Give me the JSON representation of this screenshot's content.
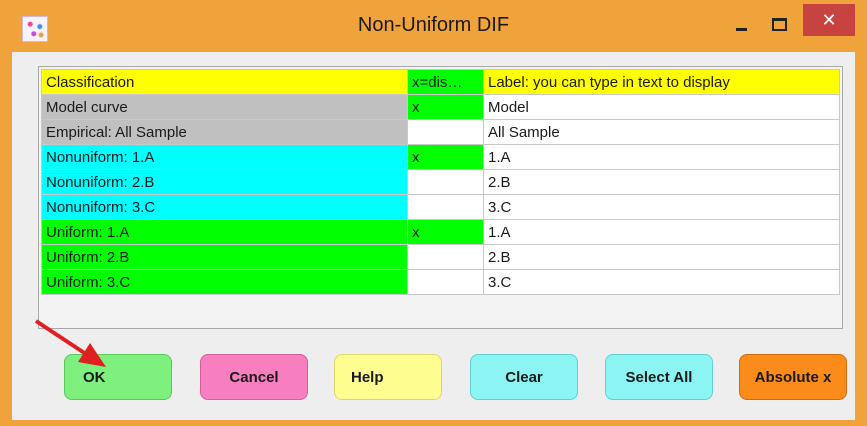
{
  "window": {
    "title": "Non-Uniform DIF",
    "minimize_glyph": "–",
    "maximize_glyph": "☐",
    "close_glyph": "✕"
  },
  "table": {
    "headers": [
      "Classification",
      "x=dis…",
      "Label: you can type in text to display"
    ],
    "rows": [
      {
        "classification": "Model curve",
        "display": "x",
        "label": "Model"
      },
      {
        "classification": "Empirical: All Sample",
        "display": "",
        "label": "All Sample"
      },
      {
        "classification": "Nonuniform: 1.A",
        "display": "x",
        "label": "1.A"
      },
      {
        "classification": "Nonuniform: 2.B",
        "display": "",
        "label": "2.B"
      },
      {
        "classification": "Nonuniform: 3.C",
        "display": "",
        "label": "3.C"
      },
      {
        "classification": "Uniform: 1.A",
        "display": "x",
        "label": "1.A"
      },
      {
        "classification": "Uniform: 2.B",
        "display": "",
        "label": "2.B"
      },
      {
        "classification": "Uniform: 3.C",
        "display": "",
        "label": "3.C"
      }
    ]
  },
  "buttons": {
    "ok": "OK",
    "cancel": "Cancel",
    "help": "Help",
    "clear": "Clear",
    "select_all": "Select All",
    "absolute_x": "Absolute x"
  },
  "colors": {
    "header_yellow": "#ffff00",
    "gray_row": "#c0c0c0",
    "cyan_row": "#00ffff",
    "green_row": "#00ff00",
    "ok_btn": "#7ef07e",
    "cancel_btn": "#f87fbf",
    "help_btn": "#fdfd90",
    "clear_btn": "#8df4f4",
    "select_all_btn": "#8df4f4",
    "absolute_btn": "#fb8b1a",
    "arrow": "#e02020",
    "title_bar": "#f0a33b"
  }
}
